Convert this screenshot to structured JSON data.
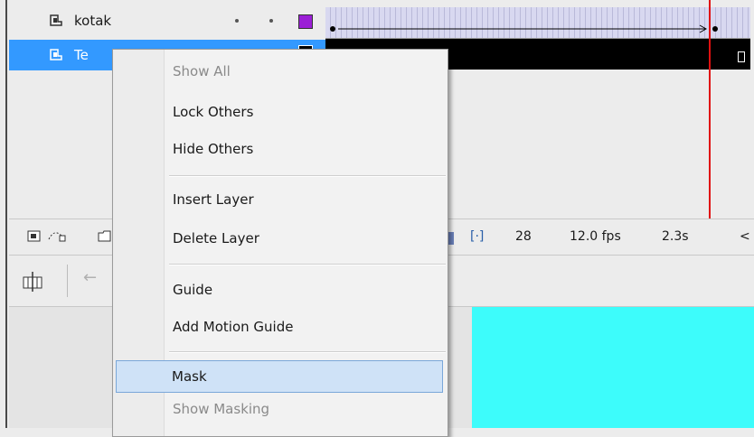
{
  "layers": [
    {
      "name": "kotak",
      "color": "#9b1fd6"
    },
    {
      "name": "Te",
      "color": "#000000"
    }
  ],
  "status": {
    "frame": "28",
    "fps": "12.0 fps",
    "time": "2.3s"
  },
  "context_menu": {
    "items": [
      {
        "label": "Show All",
        "state": "disabled"
      },
      {
        "label": "Lock Others"
      },
      {
        "label": "Hide Others"
      },
      {
        "label": "Insert Layer"
      },
      {
        "label": "Delete Layer"
      },
      {
        "label": "Guide"
      },
      {
        "label": "Add Motion Guide"
      },
      {
        "label": "Mask",
        "state": "highlighted"
      },
      {
        "label": "Show Masking",
        "state": "disabled"
      }
    ]
  },
  "colors": {
    "selection": "#3399ff",
    "stage": "#3dfcfb",
    "playhead": "#e01010",
    "menu_highlight": "#cfe2f7"
  }
}
